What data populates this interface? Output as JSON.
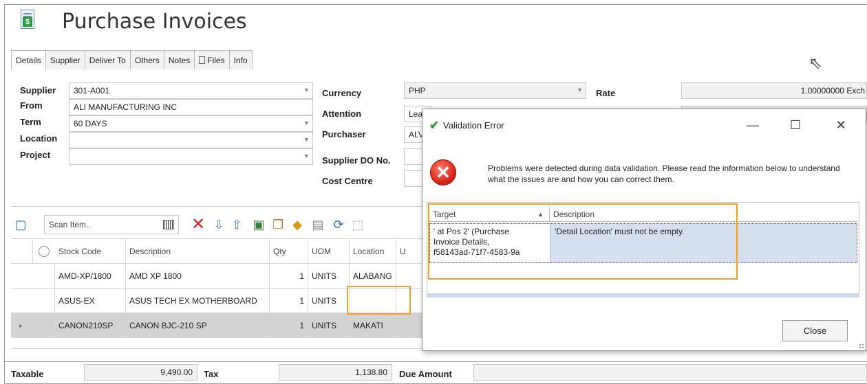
{
  "window": {
    "title": "Purchase Invoices"
  },
  "tabs": [
    "Details",
    "Supplier",
    "Deliver To",
    "Others",
    "Notes",
    "Files",
    "Info"
  ],
  "form": {
    "supplier": {
      "label": "Supplier",
      "value": "301-A001"
    },
    "from": {
      "label": "From",
      "value": "ALI MANUFACTURING INC"
    },
    "term": {
      "label": "Term",
      "value": "60 DAYS"
    },
    "location": {
      "label": "Location",
      "value": ""
    },
    "project": {
      "label": "Project",
      "value": ""
    },
    "currency": {
      "label": "Currency",
      "value": "PHP"
    },
    "attention": {
      "label": "Attention",
      "value": "Lea"
    },
    "purchaser": {
      "label": "Purchaser",
      "value": "ALV"
    },
    "supplier_do": {
      "label": "Supplier DO No.",
      "value": ""
    },
    "cost_centre": {
      "label": "Cost Centre",
      "value": ""
    },
    "rate": {
      "label": "Rate",
      "value": "1.00000000",
      "suffix": "Exch"
    }
  },
  "toolbar": {
    "scan_placeholder": "Scan Item.."
  },
  "grid": {
    "columns": [
      "Stock Code",
      "Description",
      "Qty",
      "UOM",
      "Location",
      "U"
    ],
    "rows": [
      {
        "stock_code": "AMD-XP/1800",
        "description": "AMD XP 1800",
        "qty": "1",
        "uom": "UNITS",
        "location": "ALABANG"
      },
      {
        "stock_code": "ASUS-EX",
        "description": "ASUS TECH EX MOTHERBOARD",
        "qty": "1",
        "uom": "UNITS",
        "location": ""
      },
      {
        "stock_code": "CANON210SP",
        "description": "CANON BJC-210 SP",
        "qty": "1",
        "uom": "UNITS",
        "location": "MAKATI"
      }
    ]
  },
  "totals": {
    "taxable_label": "Taxable",
    "taxable": "9,490.00",
    "tax_label": "Tax",
    "tax": "1,138.80",
    "due_label": "Due Amount",
    "due": ""
  },
  "dialog": {
    "title": "Validation Error",
    "message": "Problems were detected during data validation. Please read the information below to understand what the issues are and how you can correct them.",
    "columns": {
      "target": "Target",
      "description": "Description"
    },
    "error": {
      "target_line1": "' at Pos 2' (Purchase",
      "target_line2": "Invoice Details,",
      "target_line3": "f58143ad-71f7-4583-9a",
      "description": "'Detail Location' must not be empty."
    },
    "close_label": "Close",
    "minimize": "—",
    "maximize": "☐",
    "close_x": "✕"
  },
  "colors": {
    "highlight": "#f0a02a",
    "selected_row": "#d5dff0",
    "error_red": "#d41d12"
  }
}
